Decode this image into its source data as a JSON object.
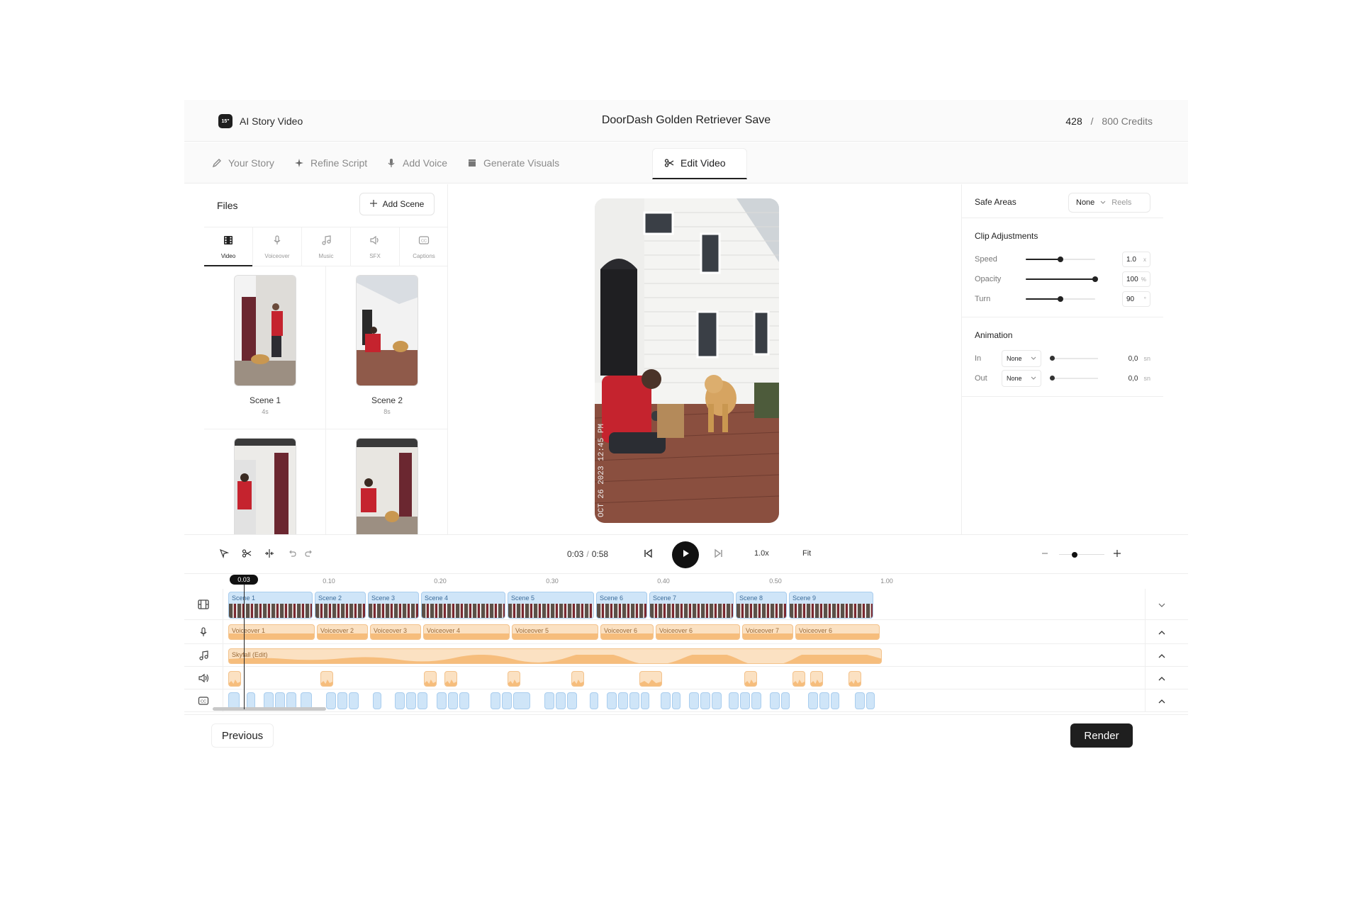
{
  "header": {
    "logo_text": "15\"",
    "app_name": "AI Story Video",
    "title": "DoorDash Golden Retriever Save",
    "credits_used": "428",
    "credits_sep": "/",
    "credits_total": "800 Credits"
  },
  "steps": [
    {
      "label": "Your Story",
      "icon": "pencil-icon"
    },
    {
      "label": "Refine Script",
      "icon": "sparkle-icon"
    },
    {
      "label": "Add Voice",
      "icon": "microphone-icon"
    },
    {
      "label": "Generate Visuals",
      "icon": "clapperboard-icon"
    },
    {
      "label": "Edit Video",
      "icon": "scissors-icon",
      "active": true
    }
  ],
  "files": {
    "title": "Files",
    "add_scene": "Add Scene",
    "tabs": [
      {
        "label": "Video",
        "icon": "film-grid-icon",
        "active": true
      },
      {
        "label": "Voiceover",
        "icon": "microphone-icon"
      },
      {
        "label": "Music",
        "icon": "music-note-icon"
      },
      {
        "label": "SFX",
        "icon": "speaker-icon"
      },
      {
        "label": "Captions",
        "icon": "cc-icon"
      }
    ],
    "scenes": [
      {
        "name": "Scene 1",
        "duration": "4s"
      },
      {
        "name": "Scene 2",
        "duration": "8s"
      },
      {
        "name": "",
        "duration": ""
      },
      {
        "name": "",
        "duration": ""
      }
    ]
  },
  "preview": {
    "overlay_date": "OCT 26 2023 12:45 PM"
  },
  "properties": {
    "safe_areas": {
      "label": "Safe Areas",
      "value": "None",
      "alt": "Reels"
    },
    "clip_adjustments": {
      "title": "Clip Adjustments",
      "speed": {
        "label": "Speed",
        "value": "1.0",
        "unit": "x",
        "level": 0.5
      },
      "opacity": {
        "label": "Opacity",
        "value": "100",
        "unit": "%",
        "level": 1.0
      },
      "turn": {
        "label": "Turn",
        "value": "90",
        "unit": "°",
        "level": 0.5
      }
    },
    "animation": {
      "title": "Animation",
      "in": {
        "label": "In",
        "select": "None",
        "value": "0,0",
        "unit": "sn"
      },
      "out": {
        "label": "Out",
        "select": "None",
        "value": "0,0",
        "unit": "sn"
      }
    }
  },
  "toolbar": {
    "current_time": "0:03",
    "time_sep": "/",
    "total_time": "0:58",
    "speed": "1.0x",
    "fit": "Fit",
    "zoom_level": 0.35
  },
  "timeline": {
    "playhead": "0.03",
    "ruler": [
      "0.10",
      "0.20",
      "0.30",
      "0.40",
      "0.50",
      "1.00"
    ],
    "video_clips": [
      "Scene 1",
      "Scene 2",
      "Scene 3",
      "Scene 4",
      "Scene 5",
      "Scene 6",
      "Scene 7",
      "Scene 8",
      "Scene 9"
    ],
    "voice_clips": [
      "Voiceover 1",
      "Voiceover 2",
      "Voiceover 3",
      "Voiceover 4",
      "Voiceover 5",
      "Voiceover 6",
      "Voiceover 6",
      "Voiceover 7",
      "Voiceover 6"
    ],
    "music_clip": "Skyfall (Edit)"
  },
  "footer": {
    "previous": "Previous",
    "render": "Render"
  },
  "colors": {
    "accent": "#1f1f1f",
    "video_clip": "#cfe5f8",
    "audio_clip": "#fbe1c2"
  }
}
